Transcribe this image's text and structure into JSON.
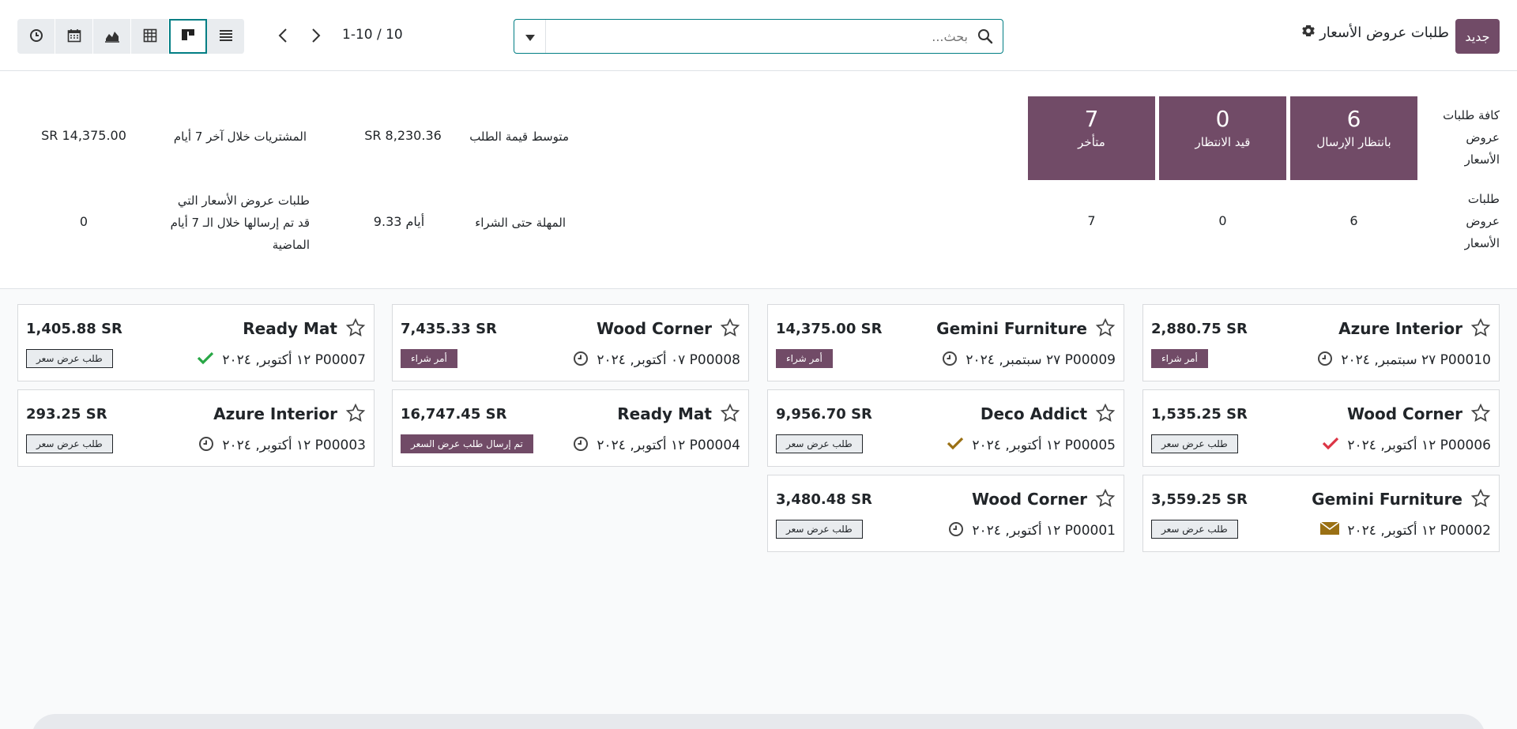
{
  "header": {
    "new_label": "جديد",
    "title": "طلبات عروض الأسعار",
    "search_placeholder": "بحث...",
    "pager": "1-10 / 10"
  },
  "views": [
    "activity-icon",
    "calendar-icon",
    "graph-icon",
    "pivot-icon",
    "kanban-icon",
    "list-icon"
  ],
  "dashboard": {
    "row1_label": "كافة طلبات عروض الأسعار",
    "row2_label": "طلبات عروض الأسعار",
    "tiles": [
      {
        "count": "6",
        "label": "بانتظار الإرسال"
      },
      {
        "count": "0",
        "label": "قيد الانتظار"
      },
      {
        "count": "7",
        "label": "متأخر"
      }
    ],
    "row2_values": [
      "6",
      "0",
      "7"
    ],
    "avg_order_label": "متوسط قيمة الطلب",
    "avg_order_value": "SR 8,230.36",
    "purchased_label": "المشتريات خلال آخر 7 أيام",
    "purchased_value": "SR 14,375.00",
    "lead_time_label": "المهلة حتى الشراء",
    "lead_time_value": "9.33 أيام",
    "sent_label": "طلبات عروض الأسعار التي قد تم إرسالها خلال الـ 7 أيام الماضية",
    "sent_value": "0"
  },
  "cards": [
    {
      "partner": "Azure Interior",
      "amount": "2,880.75 SR",
      "ref": "P00010 ٢٧ سبتمبر, ٢٠٢٤",
      "badge": "أمر شراء",
      "badge_style": "purple",
      "activity": "clock-icon"
    },
    {
      "partner": "Gemini Furniture",
      "amount": "14,375.00 SR",
      "ref": "P00009 ٢٧ سبتمبر, ٢٠٢٤",
      "badge": "أمر شراء",
      "badge_style": "purple",
      "activity": "clock-icon"
    },
    {
      "partner": "Wood Corner",
      "amount": "7,435.33 SR",
      "ref": "P00008 ٠٧ أكتوبر, ٢٠٢٤",
      "badge": "أمر شراء",
      "badge_style": "purple",
      "activity": "clock-icon"
    },
    {
      "partner": "Ready Mat",
      "amount": "1,405.88 SR",
      "ref": "P00007 ١٢ أكتوبر, ٢٠٢٤",
      "badge": "طلب عرض سعر",
      "badge_style": "gray",
      "activity": "check-green-icon"
    },
    {
      "partner": "Wood Corner",
      "amount": "1,535.25 SR",
      "ref": "P00006 ١٢ أكتوبر, ٢٠٢٤",
      "badge": "طلب عرض سعر",
      "badge_style": "gray",
      "activity": "check-red-icon"
    },
    {
      "partner": "Deco Addict",
      "amount": "9,956.70 SR",
      "ref": "P00005 ١٢ أكتوبر, ٢٠٢٤",
      "badge": "طلب عرض سعر",
      "badge_style": "gray",
      "activity": "check-yellow-icon"
    },
    {
      "partner": "Ready Mat",
      "amount": "16,747.45 SR",
      "ref": "P00004 ١٢ أكتوبر, ٢٠٢٤",
      "badge": "تم إرسال طلب عرض السعر",
      "badge_style": "purple",
      "activity": "clock-icon"
    },
    {
      "partner": "Azure Interior",
      "amount": "293.25 SR",
      "ref": "P00003 ١٢ أكتوبر, ٢٠٢٤",
      "badge": "طلب عرض سعر",
      "badge_style": "gray",
      "activity": "clock-icon"
    },
    {
      "partner": "Gemini Furniture",
      "amount": "3,559.25 SR",
      "ref": "P00002 ١٢ أكتوبر, ٢٠٢٤",
      "badge": "طلب عرض سعر",
      "badge_style": "gray",
      "activity": "envelope-icon"
    },
    {
      "partner": "Wood Corner",
      "amount": "3,480.48 SR",
      "ref": "P00001 ١٢ أكتوبر, ٢٠٢٤",
      "badge": "طلب عرض سعر",
      "badge_style": "gray",
      "activity": "clock-icon"
    }
  ]
}
